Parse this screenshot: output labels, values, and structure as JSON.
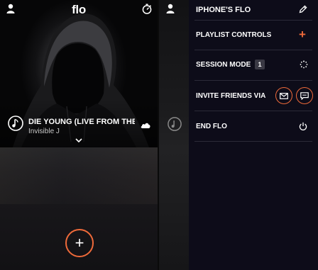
{
  "left_screen": {
    "header": {
      "logo": "flo",
      "user_icon": "user-icon",
      "timer_icon": "timer-icon"
    },
    "now_playing": {
      "title": "DIE YOUNG (LIVE FROM THE...",
      "artist": "Invisible J",
      "track_icon": "music-note-icon",
      "source_icon": "cloud-icon"
    },
    "add_button_icon": "plus-icon",
    "accent_color": "#ef6a3a"
  },
  "drawer": {
    "title": "IPHONE'S FLO",
    "title_icon": "pencil-icon",
    "items": [
      {
        "label": "PLAYLIST CONTROLS",
        "icon": "plus-icon"
      },
      {
        "label": "SESSION MODE",
        "badge": "1",
        "icon": "spinner-icon"
      },
      {
        "label": "INVITE FRIENDS VIA",
        "icons": [
          "mail-icon",
          "message-icon"
        ]
      },
      {
        "label": "END FLO",
        "icon": "power-icon"
      }
    ]
  }
}
